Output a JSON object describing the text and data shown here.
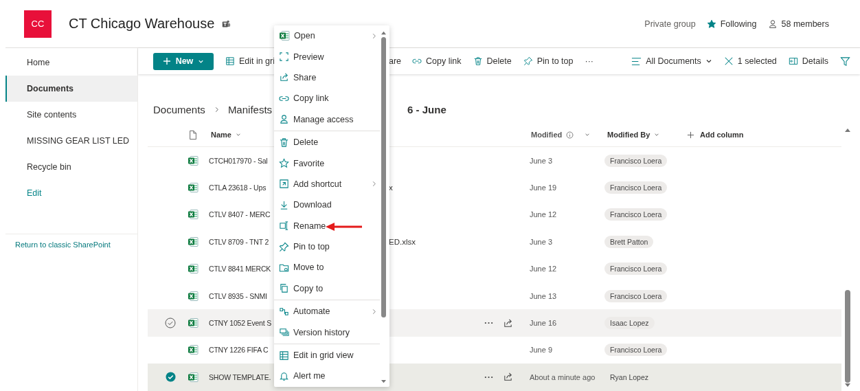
{
  "site": {
    "logo": "CC",
    "title": "CT Chicago Warehouse",
    "privacy": "Private group",
    "follow": {
      "label": "Following",
      "following": true
    },
    "members": "58 members"
  },
  "nav": {
    "items": [
      {
        "label": "Home",
        "kind": "page",
        "selected": false
      },
      {
        "label": "Documents",
        "kind": "page",
        "selected": true
      },
      {
        "label": "Site contents",
        "kind": "page",
        "selected": false
      },
      {
        "label": "MISSING GEAR LIST LED",
        "kind": "page",
        "selected": false
      },
      {
        "label": "Recycle bin",
        "kind": "page",
        "selected": false
      },
      {
        "label": "Edit",
        "kind": "link",
        "selected": false
      }
    ],
    "footer_link": "Return to classic SharePoint"
  },
  "command_bar": {
    "new_button": "New",
    "actions": [
      {
        "label": "Edit in gri"
      },
      {
        "label": "are"
      },
      {
        "label": "Copy link"
      },
      {
        "label": "Delete"
      },
      {
        "label": "Pin to top"
      },
      {
        "label": "···"
      }
    ],
    "view": "All Documents",
    "selection": "1 selected",
    "details": "Details"
  },
  "breadcrumb": {
    "items": [
      "Documents",
      "Manifests"
    ],
    "tail": "6 - June"
  },
  "table": {
    "columns": {
      "name": "Name",
      "modified": "Modified",
      "modified_by": "Modified By",
      "add": "Add column"
    },
    "rows": [
      {
        "name": "CTCH017970 - Sal",
        "modified": "June 3",
        "modified_by": "Francisco Loera",
        "selected": false,
        "hovered": false
      },
      {
        "name": "CTLA 23618 - Ups",
        "name_tail": "x",
        "modified": "June 19",
        "modified_by": "Francisco Loera",
        "selected": false,
        "hovered": false
      },
      {
        "name": "CTLV 8407 - MERC",
        "modified": "June 12",
        "modified_by": "Francisco Loera",
        "selected": false,
        "hovered": false
      },
      {
        "name": "CTLV 8709 - TNT 2",
        "name_tail": "ED.xlsx",
        "modified": "June 3",
        "modified_by": "Brett Patton",
        "selected": false,
        "hovered": false
      },
      {
        "name": "CTLV 8841 MERCK",
        "modified": "June 12",
        "modified_by": "Francisco Loera",
        "selected": false,
        "hovered": false
      },
      {
        "name": "CTLV 8935 - SNMI",
        "modified": "June 13",
        "modified_by": "Francisco Loera",
        "selected": false,
        "hovered": false
      },
      {
        "name": "CTNY 1052 Event S",
        "modified": "June 16",
        "modified_by": "Isaac Lopez",
        "selected": false,
        "hovered": true
      },
      {
        "name": "CTNY 1226 FIFA C",
        "modified": "June 9",
        "modified_by": "Francisco Loera",
        "selected": false,
        "hovered": false
      },
      {
        "name": "SHOW TEMPLATE.",
        "modified": "About a minute ago",
        "modified_by": "Ryan Lopez",
        "selected": true,
        "hovered": false
      }
    ]
  },
  "context_menu": {
    "groups": [
      [
        {
          "label": "Open",
          "has_submenu": true
        },
        {
          "label": "Preview",
          "has_submenu": false
        },
        {
          "label": "Share",
          "has_submenu": false
        },
        {
          "label": "Copy link",
          "has_submenu": false
        },
        {
          "label": "Manage access",
          "has_submenu": false
        }
      ],
      [
        {
          "label": "Delete",
          "has_submenu": false
        },
        {
          "label": "Favorite",
          "has_submenu": false
        },
        {
          "label": "Add shortcut",
          "has_submenu": true
        },
        {
          "label": "Download",
          "has_submenu": false
        },
        {
          "label": "Rename",
          "has_submenu": false
        },
        {
          "label": "Pin to top",
          "has_submenu": false
        },
        {
          "label": "Move to",
          "has_submenu": false
        },
        {
          "label": "Copy to",
          "has_submenu": false
        }
      ],
      [
        {
          "label": "Automate",
          "has_submenu": true
        },
        {
          "label": "Version history",
          "has_submenu": false
        }
      ],
      [
        {
          "label": "Edit in grid view",
          "has_submenu": false
        },
        {
          "label": "Alert me",
          "has_submenu": false
        }
      ]
    ]
  }
}
